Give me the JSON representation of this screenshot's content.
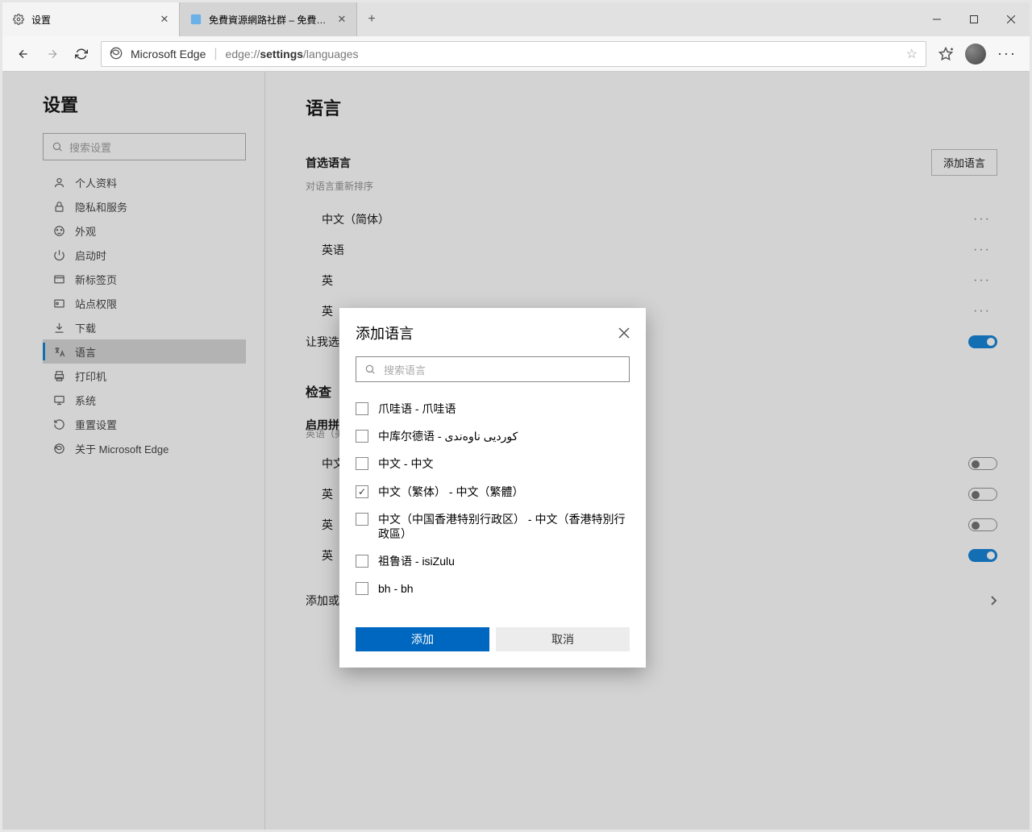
{
  "tabs": [
    {
      "title": "设置",
      "icon": "gear"
    },
    {
      "title": "免費資源網路社群 – 免費資源指…",
      "icon": "page"
    }
  ],
  "addressbar": {
    "brand": "Microsoft Edge",
    "url_prefix": "edge://",
    "url_bold": "settings",
    "url_suffix": "/languages"
  },
  "sidebar": {
    "title": "设置",
    "search_placeholder": "搜索设置",
    "items": [
      {
        "label": "个人资料",
        "icon": "person"
      },
      {
        "label": "隐私和服务",
        "icon": "lock"
      },
      {
        "label": "外观",
        "icon": "palette"
      },
      {
        "label": "启动时",
        "icon": "power"
      },
      {
        "label": "新标签页",
        "icon": "tab"
      },
      {
        "label": "站点权限",
        "icon": "site"
      },
      {
        "label": "下载",
        "icon": "download"
      },
      {
        "label": "语言",
        "icon": "lang",
        "active": true
      },
      {
        "label": "打印机",
        "icon": "printer"
      },
      {
        "label": "系统",
        "icon": "system"
      },
      {
        "label": "重置设置",
        "icon": "reset"
      },
      {
        "label": "关于 Microsoft Edge",
        "icon": "edge"
      }
    ]
  },
  "main": {
    "heading": "语言",
    "pref_title": "首选语言",
    "add_button": "添加语言",
    "pref_sub": "对语言重新排序",
    "langs": [
      "中文（简体）",
      "英语",
      "英",
      "英"
    ],
    "let_me": "让我选",
    "check_title": "检查",
    "enable_title": "启用拼",
    "enable_sub": "英语（美",
    "sub_rows": [
      "中文",
      "英",
      "英",
      "英"
    ],
    "add_or": "添加或"
  },
  "dialog": {
    "title": "添加语言",
    "search_placeholder": "搜索语言",
    "options": [
      {
        "label": "爪哇语 - 爪哇语",
        "checked": false
      },
      {
        "label": "中库尔德语 - کوردیی ناوەندی",
        "checked": false
      },
      {
        "label": "中文 - 中文",
        "checked": false
      },
      {
        "label": "中文（繁体） - 中文（繁體）",
        "checked": true
      },
      {
        "label": "中文（中国香港特别行政区） - 中文（香港特別行政區）",
        "checked": false
      },
      {
        "label": "祖鲁语 - isiZulu",
        "checked": false
      },
      {
        "label": "bh - bh",
        "checked": false
      }
    ],
    "add_btn": "添加",
    "cancel_btn": "取消"
  }
}
